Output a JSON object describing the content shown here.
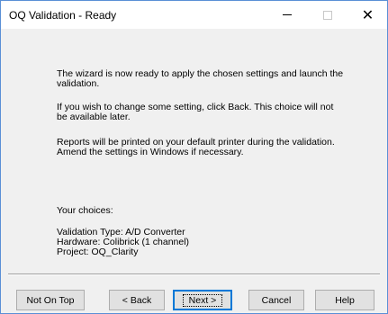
{
  "window": {
    "title": "OQ Validation - Ready"
  },
  "titlebar_icons": {
    "minimize": "minimize-icon",
    "maximize": "maximize-icon",
    "close": "close-icon"
  },
  "body": {
    "paragraph1": "The wizard is now ready to apply the chosen settings and launch the validation.",
    "paragraph2": "If you wish to change some setting, click Back. This choice will not be available later.",
    "paragraph3": "Reports will be printed on your default printer during the validation. Amend the settings in Windows if necessary.",
    "choices_title": "Your choices:",
    "choices": [
      "Validation Type: A/D Converter",
      "Hardware: Colibrick (1 channel)",
      "Project: OQ_Clarity"
    ]
  },
  "buttons": {
    "not_on_top": "Not On Top",
    "back": "< Back",
    "next": "Next >",
    "cancel": "Cancel",
    "help": "Help"
  }
}
